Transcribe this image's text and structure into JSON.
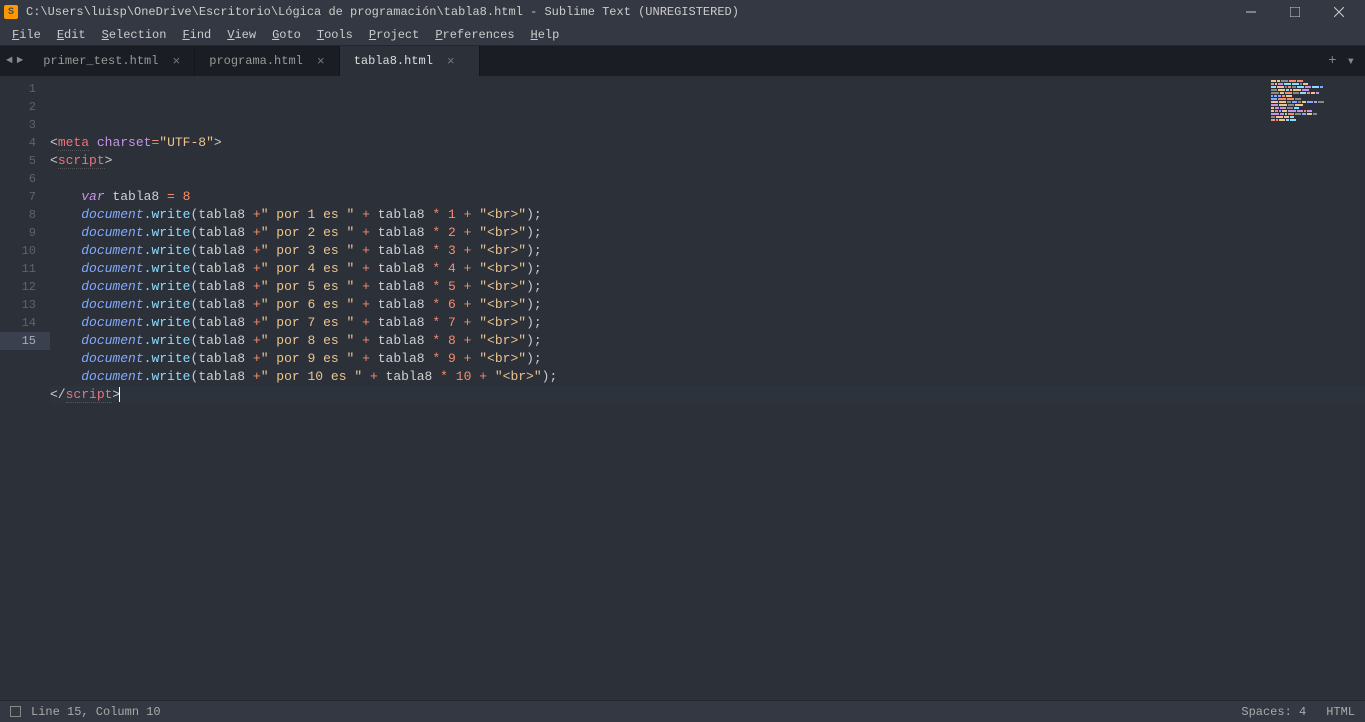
{
  "window": {
    "title": "C:\\Users\\luisp\\OneDrive\\Escritorio\\Lógica de programación\\tabla8.html - Sublime Text (UNREGISTERED)"
  },
  "menu": {
    "items": [
      "File",
      "Edit",
      "Selection",
      "Find",
      "View",
      "Goto",
      "Tools",
      "Project",
      "Preferences",
      "Help"
    ]
  },
  "tabs": {
    "items": [
      {
        "label": "primer_test.html",
        "active": false
      },
      {
        "label": "programa.html",
        "active": false
      },
      {
        "label": "tabla8.html",
        "active": true
      }
    ]
  },
  "editor": {
    "current_line": 15,
    "lines": [
      {
        "n": 1,
        "tokens": [
          [
            "<",
            "c-punct"
          ],
          [
            "meta",
            "c-tag dashed"
          ],
          [
            " ",
            "c-punct"
          ],
          [
            "charset",
            "c-attr"
          ],
          [
            "=",
            "c-op"
          ],
          [
            "\"UTF-8\"",
            "c-string"
          ],
          [
            ">",
            "c-punct"
          ]
        ]
      },
      {
        "n": 2,
        "tokens": [
          [
            "<",
            "c-punct"
          ],
          [
            "script",
            "c-tag dashed"
          ],
          [
            ">",
            "c-punct"
          ]
        ]
      },
      {
        "n": 3,
        "tokens": [
          [
            "",
            "c-punct"
          ]
        ]
      },
      {
        "n": 4,
        "tokens": [
          [
            "    ",
            "c-punct"
          ],
          [
            "var",
            "c-keyword"
          ],
          [
            " tabla8 ",
            "c-var"
          ],
          [
            "=",
            "c-op"
          ],
          [
            " ",
            "c-var"
          ],
          [
            "8",
            "c-num"
          ]
        ]
      },
      {
        "n": 5,
        "tokens": [
          [
            "    ",
            "c-punct"
          ],
          [
            "document",
            "c-obj"
          ],
          [
            ".",
            "c-dot"
          ],
          [
            "write",
            "c-method"
          ],
          [
            "(",
            "c-punct"
          ],
          [
            "tabla8 ",
            "c-var"
          ],
          [
            "+",
            "c-op"
          ],
          [
            "\" por 1 es \"",
            "c-string"
          ],
          [
            " ",
            "c-var"
          ],
          [
            "+",
            "c-op"
          ],
          [
            " tabla8 ",
            "c-var"
          ],
          [
            "*",
            "c-star"
          ],
          [
            " ",
            "c-var"
          ],
          [
            "1",
            "c-num"
          ],
          [
            " ",
            "c-var"
          ],
          [
            "+",
            "c-op"
          ],
          [
            " ",
            "c-var"
          ],
          [
            "\"<br>\"",
            "c-string"
          ],
          [
            ")",
            "c-punct"
          ],
          [
            ";",
            "c-punct"
          ]
        ]
      },
      {
        "n": 6,
        "tokens": [
          [
            "    ",
            "c-punct"
          ],
          [
            "document",
            "c-obj"
          ],
          [
            ".",
            "c-dot"
          ],
          [
            "write",
            "c-method"
          ],
          [
            "(",
            "c-punct"
          ],
          [
            "tabla8 ",
            "c-var"
          ],
          [
            "+",
            "c-op"
          ],
          [
            "\" por 2 es \"",
            "c-string"
          ],
          [
            " ",
            "c-var"
          ],
          [
            "+",
            "c-op"
          ],
          [
            " tabla8 ",
            "c-var"
          ],
          [
            "*",
            "c-star"
          ],
          [
            " ",
            "c-var"
          ],
          [
            "2",
            "c-num"
          ],
          [
            " ",
            "c-var"
          ],
          [
            "+",
            "c-op"
          ],
          [
            " ",
            "c-var"
          ],
          [
            "\"<br>\"",
            "c-string"
          ],
          [
            ")",
            "c-punct"
          ],
          [
            ";",
            "c-punct"
          ]
        ]
      },
      {
        "n": 7,
        "tokens": [
          [
            "    ",
            "c-punct"
          ],
          [
            "document",
            "c-obj"
          ],
          [
            ".",
            "c-dot"
          ],
          [
            "write",
            "c-method"
          ],
          [
            "(",
            "c-punct"
          ],
          [
            "tabla8 ",
            "c-var"
          ],
          [
            "+",
            "c-op"
          ],
          [
            "\" por 3 es \"",
            "c-string"
          ],
          [
            " ",
            "c-var"
          ],
          [
            "+",
            "c-op"
          ],
          [
            " tabla8 ",
            "c-var"
          ],
          [
            "*",
            "c-star"
          ],
          [
            " ",
            "c-var"
          ],
          [
            "3",
            "c-num"
          ],
          [
            " ",
            "c-var"
          ],
          [
            "+",
            "c-op"
          ],
          [
            " ",
            "c-var"
          ],
          [
            "\"<br>\"",
            "c-string"
          ],
          [
            ")",
            "c-punct"
          ],
          [
            ";",
            "c-punct"
          ]
        ]
      },
      {
        "n": 8,
        "tokens": [
          [
            "    ",
            "c-punct"
          ],
          [
            "document",
            "c-obj"
          ],
          [
            ".",
            "c-dot"
          ],
          [
            "write",
            "c-method"
          ],
          [
            "(",
            "c-punct"
          ],
          [
            "tabla8 ",
            "c-var"
          ],
          [
            "+",
            "c-op"
          ],
          [
            "\" por 4 es \"",
            "c-string"
          ],
          [
            " ",
            "c-var"
          ],
          [
            "+",
            "c-op"
          ],
          [
            " tabla8 ",
            "c-var"
          ],
          [
            "*",
            "c-star"
          ],
          [
            " ",
            "c-var"
          ],
          [
            "4",
            "c-num"
          ],
          [
            " ",
            "c-var"
          ],
          [
            "+",
            "c-op"
          ],
          [
            " ",
            "c-var"
          ],
          [
            "\"<br>\"",
            "c-string"
          ],
          [
            ")",
            "c-punct"
          ],
          [
            ";",
            "c-punct"
          ]
        ]
      },
      {
        "n": 9,
        "tokens": [
          [
            "    ",
            "c-punct"
          ],
          [
            "document",
            "c-obj"
          ],
          [
            ".",
            "c-dot"
          ],
          [
            "write",
            "c-method"
          ],
          [
            "(",
            "c-punct"
          ],
          [
            "tabla8 ",
            "c-var"
          ],
          [
            "+",
            "c-op"
          ],
          [
            "\" por 5 es \"",
            "c-string"
          ],
          [
            " ",
            "c-var"
          ],
          [
            "+",
            "c-op"
          ],
          [
            " tabla8 ",
            "c-var"
          ],
          [
            "*",
            "c-star"
          ],
          [
            " ",
            "c-var"
          ],
          [
            "5",
            "c-num"
          ],
          [
            " ",
            "c-var"
          ],
          [
            "+",
            "c-op"
          ],
          [
            " ",
            "c-var"
          ],
          [
            "\"<br>\"",
            "c-string"
          ],
          [
            ")",
            "c-punct"
          ],
          [
            ";",
            "c-punct"
          ]
        ]
      },
      {
        "n": 10,
        "tokens": [
          [
            "    ",
            "c-punct"
          ],
          [
            "document",
            "c-obj"
          ],
          [
            ".",
            "c-dot"
          ],
          [
            "write",
            "c-method"
          ],
          [
            "(",
            "c-punct"
          ],
          [
            "tabla8 ",
            "c-var"
          ],
          [
            "+",
            "c-op"
          ],
          [
            "\" por 6 es \"",
            "c-string"
          ],
          [
            " ",
            "c-var"
          ],
          [
            "+",
            "c-op"
          ],
          [
            " tabla8 ",
            "c-var"
          ],
          [
            "*",
            "c-star"
          ],
          [
            " ",
            "c-var"
          ],
          [
            "6",
            "c-num"
          ],
          [
            " ",
            "c-var"
          ],
          [
            "+",
            "c-op"
          ],
          [
            " ",
            "c-var"
          ],
          [
            "\"<br>\"",
            "c-string"
          ],
          [
            ")",
            "c-punct"
          ],
          [
            ";",
            "c-punct"
          ]
        ]
      },
      {
        "n": 11,
        "tokens": [
          [
            "    ",
            "c-punct"
          ],
          [
            "document",
            "c-obj"
          ],
          [
            ".",
            "c-dot"
          ],
          [
            "write",
            "c-method"
          ],
          [
            "(",
            "c-punct"
          ],
          [
            "tabla8 ",
            "c-var"
          ],
          [
            "+",
            "c-op"
          ],
          [
            "\" por 7 es \"",
            "c-string"
          ],
          [
            " ",
            "c-var"
          ],
          [
            "+",
            "c-op"
          ],
          [
            " tabla8 ",
            "c-var"
          ],
          [
            "*",
            "c-star"
          ],
          [
            " ",
            "c-var"
          ],
          [
            "7",
            "c-num"
          ],
          [
            " ",
            "c-var"
          ],
          [
            "+",
            "c-op"
          ],
          [
            " ",
            "c-var"
          ],
          [
            "\"<br>\"",
            "c-string"
          ],
          [
            ")",
            "c-punct"
          ],
          [
            ";",
            "c-punct"
          ]
        ]
      },
      {
        "n": 12,
        "tokens": [
          [
            "    ",
            "c-punct"
          ],
          [
            "document",
            "c-obj"
          ],
          [
            ".",
            "c-dot"
          ],
          [
            "write",
            "c-method"
          ],
          [
            "(",
            "c-punct"
          ],
          [
            "tabla8 ",
            "c-var"
          ],
          [
            "+",
            "c-op"
          ],
          [
            "\" por 8 es \"",
            "c-string"
          ],
          [
            " ",
            "c-var"
          ],
          [
            "+",
            "c-op"
          ],
          [
            " tabla8 ",
            "c-var"
          ],
          [
            "*",
            "c-star"
          ],
          [
            " ",
            "c-var"
          ],
          [
            "8",
            "c-num"
          ],
          [
            " ",
            "c-var"
          ],
          [
            "+",
            "c-op"
          ],
          [
            " ",
            "c-var"
          ],
          [
            "\"<br>\"",
            "c-string"
          ],
          [
            ")",
            "c-punct"
          ],
          [
            ";",
            "c-punct"
          ]
        ]
      },
      {
        "n": 13,
        "tokens": [
          [
            "    ",
            "c-punct"
          ],
          [
            "document",
            "c-obj"
          ],
          [
            ".",
            "c-dot"
          ],
          [
            "write",
            "c-method"
          ],
          [
            "(",
            "c-punct"
          ],
          [
            "tabla8 ",
            "c-var"
          ],
          [
            "+",
            "c-op"
          ],
          [
            "\" por 9 es \"",
            "c-string"
          ],
          [
            " ",
            "c-var"
          ],
          [
            "+",
            "c-op"
          ],
          [
            " tabla8 ",
            "c-var"
          ],
          [
            "*",
            "c-star"
          ],
          [
            " ",
            "c-var"
          ],
          [
            "9",
            "c-num"
          ],
          [
            " ",
            "c-var"
          ],
          [
            "+",
            "c-op"
          ],
          [
            " ",
            "c-var"
          ],
          [
            "\"<br>\"",
            "c-string"
          ],
          [
            ")",
            "c-punct"
          ],
          [
            ";",
            "c-punct"
          ]
        ]
      },
      {
        "n": 14,
        "tokens": [
          [
            "    ",
            "c-punct"
          ],
          [
            "document",
            "c-obj"
          ],
          [
            ".",
            "c-dot"
          ],
          [
            "write",
            "c-method"
          ],
          [
            "(",
            "c-punct"
          ],
          [
            "tabla8 ",
            "c-var"
          ],
          [
            "+",
            "c-op"
          ],
          [
            "\" por 10 es \"",
            "c-string"
          ],
          [
            " ",
            "c-var"
          ],
          [
            "+",
            "c-op"
          ],
          [
            " tabla8 ",
            "c-var"
          ],
          [
            "*",
            "c-star"
          ],
          [
            " ",
            "c-var"
          ],
          [
            "10",
            "c-num"
          ],
          [
            " ",
            "c-var"
          ],
          [
            "+",
            "c-op"
          ],
          [
            " ",
            "c-var"
          ],
          [
            "\"<br>\"",
            "c-string"
          ],
          [
            ")",
            "c-punct"
          ],
          [
            ";",
            "c-punct"
          ]
        ]
      },
      {
        "n": 15,
        "tokens": [
          [
            "</",
            "c-punct"
          ],
          [
            "script",
            "c-tag dashed"
          ],
          [
            ">",
            "c-punct"
          ]
        ],
        "cursor": true
      }
    ]
  },
  "statusbar": {
    "position": "Line 15, Column 10",
    "spaces": "Spaces: 4",
    "language": "HTML"
  }
}
